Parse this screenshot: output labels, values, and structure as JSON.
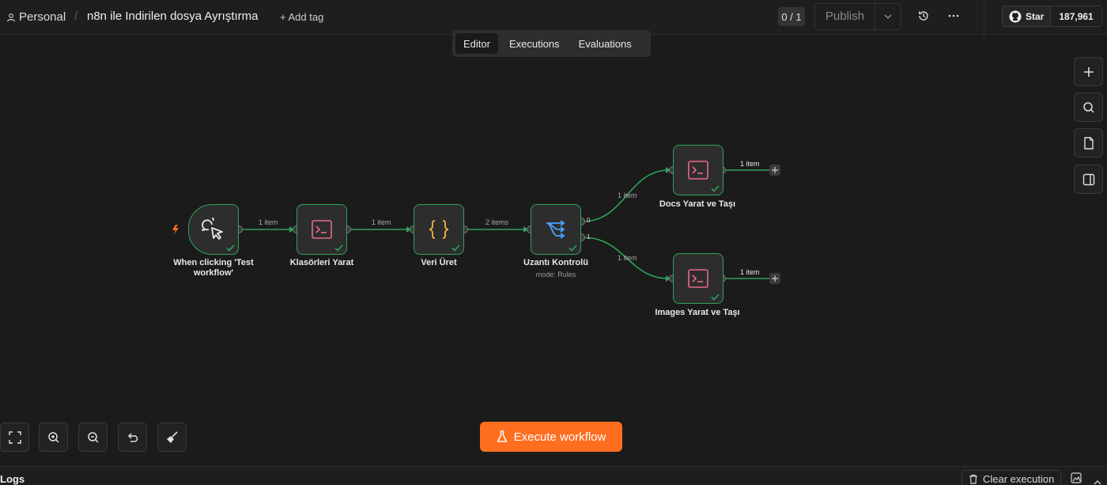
{
  "header": {
    "project": "Personal",
    "separator": "/",
    "workflow_title": "n8n ile Indirilen dosya Ayrıştırma",
    "add_tag": "+ Add tag",
    "counter": "0 / 1",
    "publish": "Publish",
    "github": {
      "star_label": "Star",
      "star_count": "187,961"
    }
  },
  "tabs": [
    {
      "label": "Editor",
      "active": true
    },
    {
      "label": "Executions",
      "active": false
    },
    {
      "label": "Evaluations",
      "active": false
    }
  ],
  "nodes": {
    "trigger": {
      "label": "When clicking 'Test workflow'",
      "icon": "pointer-click-icon"
    },
    "klasorler": {
      "label": "Klasörleri Yarat",
      "icon": "terminal-icon"
    },
    "veri": {
      "label": "Veri Üret",
      "icon": "code-braces-icon"
    },
    "uzanti": {
      "label": "Uzantı Kontrolü",
      "sub": "mode: Rules",
      "icon": "switch-icon"
    },
    "docs": {
      "label": "Docs Yarat ve Taşı",
      "icon": "terminal-icon"
    },
    "images": {
      "label": "Images Yarat ve Taşı",
      "icon": "terminal-icon"
    }
  },
  "edges": {
    "e1": "1 item",
    "e2": "1 item",
    "e3": "2 items",
    "e4": "1 item",
    "e5": "1 item",
    "docs_out": "1 item",
    "images_out": "1 item",
    "port0": "0",
    "port1": "1"
  },
  "execute_button": "Execute workflow",
  "logs": {
    "label": "Logs",
    "clear": "Clear execution"
  },
  "colors": {
    "success": "#2fa35a",
    "accent": "#ff6d1f",
    "terminal": "#e86a8a",
    "braces": "#f5b642",
    "switch": "#4aa3ff"
  }
}
